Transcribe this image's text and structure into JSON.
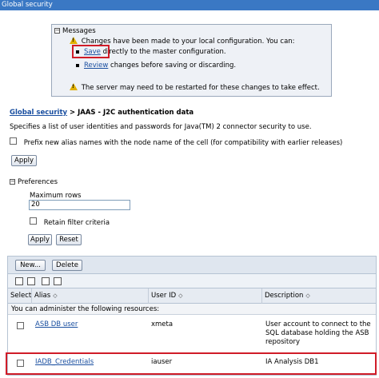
{
  "window": {
    "title": "Global security"
  },
  "messages": {
    "header": "Messages",
    "intro": "Changes have been made to your local configuration. You can:",
    "save_link": "Save",
    "save_text": " directly to the master configuration.",
    "review_link": "Review",
    "review_text": " changes before saving or discarding.",
    "restart": "The server may need to be restarted for these changes to take effect."
  },
  "breadcrumb": {
    "link": "Global security",
    "rest": " > JAAS - J2C authentication data"
  },
  "description": "Specifies a list of user identities and passwords for Java(TM) 2 connector security to use.",
  "prefix_option": "Prefix new alias names with the node name of the cell (for compatibility with earlier releases)",
  "apply_label": "Apply",
  "preferences": {
    "header": "Preferences",
    "max_rows_label": "Maximum rows",
    "max_rows_value": "20",
    "retain_label": "Retain filter criteria",
    "apply_label": "Apply",
    "reset_label": "Reset"
  },
  "table": {
    "new_label": "New...",
    "delete_label": "Delete",
    "columns": [
      "Select",
      "Alias",
      "User ID",
      "Description"
    ],
    "sort_glyph": "◇",
    "admin_text": "You can administer the following resources:",
    "rows": [
      {
        "alias": "ASB DB user",
        "user_id": "xmeta",
        "description": "User account to connect to the SQL database holding the ASB repository"
      },
      {
        "alias": "IADB_Credentials",
        "user_id": "iauser",
        "description": "IA Analysis DB1"
      }
    ]
  },
  "colors": {
    "titlebar": "#3a78c4",
    "highlight": "#d01c28",
    "link": "#1a4fa0"
  }
}
